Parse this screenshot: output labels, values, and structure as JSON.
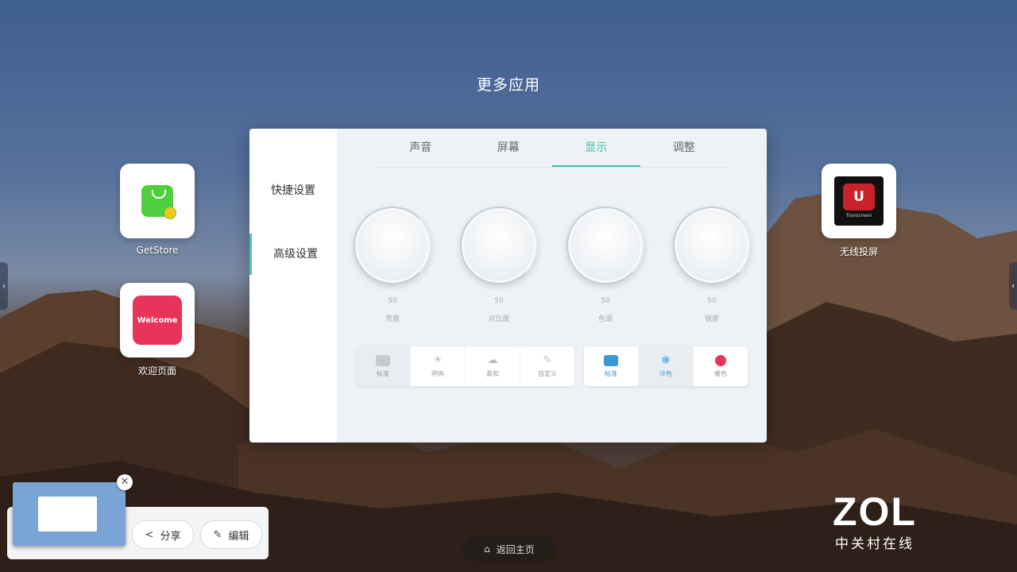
{
  "page": {
    "title": "更多应用"
  },
  "apps": [
    {
      "label": "GetStore"
    },
    {
      "label": "欢迎页面",
      "icon_text": "Welcome"
    },
    {
      "label": "无线投屏",
      "icon_text": "Transcreen"
    }
  ],
  "settings_panel": {
    "sidebar": [
      {
        "label": "快捷设置"
      },
      {
        "label": "高级设置",
        "active": true
      }
    ],
    "tabs": [
      {
        "label": "声音"
      },
      {
        "label": "屏幕"
      },
      {
        "label": "显示",
        "active": true
      },
      {
        "label": "调整"
      }
    ],
    "knobs": [
      {
        "value": "50",
        "label": "亮度"
      },
      {
        "value": "50",
        "label": "对比度"
      },
      {
        "value": "50",
        "label": "色调"
      },
      {
        "value": "50",
        "label": "锐度"
      }
    ],
    "scene_modes": [
      {
        "label": "标准"
      },
      {
        "label": "明亮"
      },
      {
        "label": "柔和"
      },
      {
        "label": "自定义"
      }
    ],
    "color_modes": [
      {
        "label": "标准"
      },
      {
        "label": "冷色"
      },
      {
        "label": "暖色"
      }
    ],
    "accent_color": "#3bbfae"
  },
  "home_button": {
    "label": "返回主页"
  },
  "screenshot_tray": {
    "share_label": "分享",
    "edit_label": "编辑"
  },
  "watermark": {
    "brand": "ZOL",
    "sub": "中关村在线"
  }
}
